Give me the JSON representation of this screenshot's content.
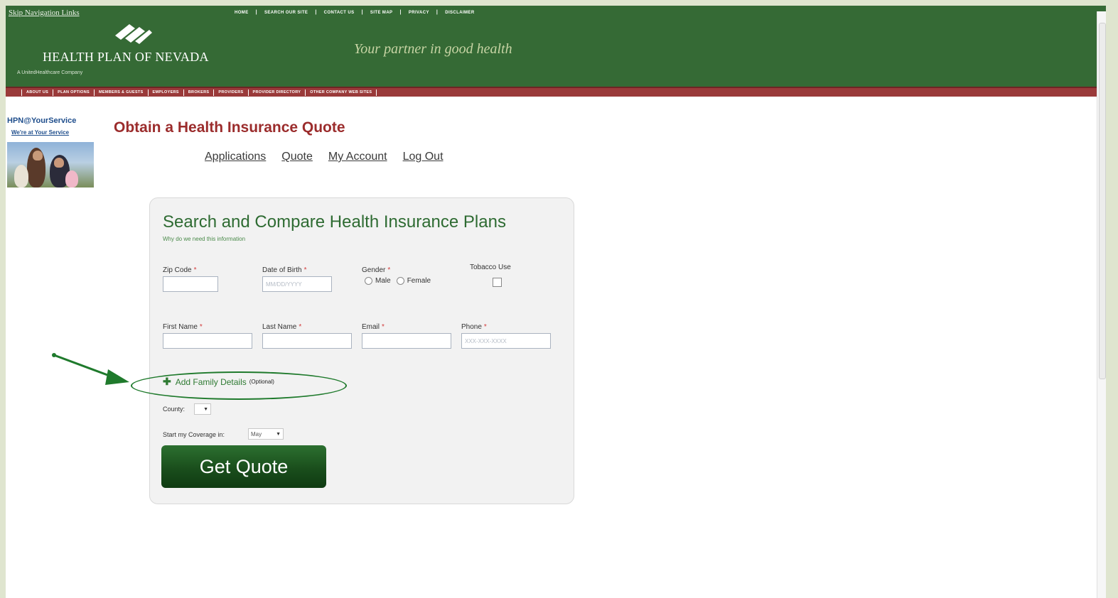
{
  "skip_link": "Skip Navigation Links",
  "top_nav": [
    "HOME",
    "SEARCH OUR SITE",
    "CONTACT US",
    "SITE MAP",
    "PRIVACY",
    "DISCLAIMER"
  ],
  "logo": {
    "name": "HEALTH PLAN OF NEVADA",
    "sub": "A UnitedHealthcare Company"
  },
  "tagline": "Your partner in good health",
  "main_nav": [
    "ABOUT US",
    "PLAN OPTIONS",
    "MEMBERS & GUESTS",
    "EMPLOYERS",
    "BROKERS",
    "PROVIDERS",
    "PROVIDER DIRECTORY",
    "OTHER COMPANY WEB SITES"
  ],
  "service": {
    "title": "HPN@YourService",
    "subtitle": "We're at Your Service"
  },
  "page_title": "Obtain a Health Insurance Quote",
  "user_nav": [
    "Applications",
    "Quote",
    "My Account",
    "Log Out"
  ],
  "form": {
    "title": "Search and Compare Health Insurance Plans",
    "why": "Why do we need this information",
    "zip_label": "Zip Code",
    "dob_label": "Date of Birth",
    "dob_placeholder": "MM/DD/YYYY",
    "gender_label": "Gender",
    "gender_options": [
      "Male",
      "Female"
    ],
    "tobacco_label": "Tobacco Use",
    "first_name_label": "First Name",
    "last_name_label": "Last Name",
    "email_label": "Email",
    "phone_label": "Phone",
    "phone_placeholder": "XXX-XXX-XXXX",
    "add_family": "Add Family Details",
    "optional": "(Optional)",
    "county_label": "County:",
    "coverage_label": "Start my Coverage in:",
    "coverage_value": "May",
    "submit": "Get Quote"
  }
}
